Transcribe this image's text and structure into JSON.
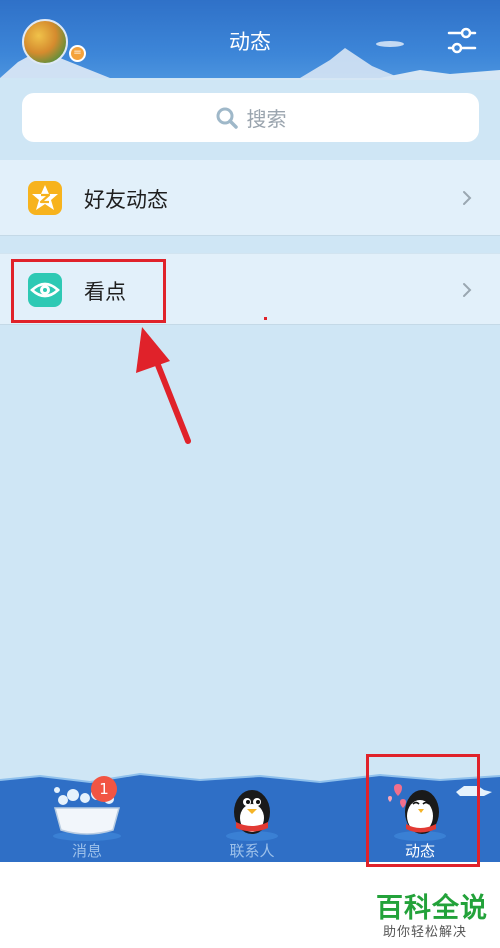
{
  "header": {
    "title": "动态",
    "avatar_badge": "=",
    "settings_icon": "sliders-icon"
  },
  "search": {
    "placeholder": "搜索",
    "icon": "search-icon"
  },
  "rows": [
    {
      "label": "好友动态",
      "icon": "star-z-icon",
      "icon_color": "#f7b31d"
    },
    {
      "label": "看点",
      "icon": "eye-icon",
      "icon_color": "#2ec9b4"
    }
  ],
  "tabbar": {
    "tabs": [
      {
        "label": "消息",
        "icon": "bathtub-icon",
        "badge": "1",
        "active": false
      },
      {
        "label": "联系人",
        "icon": "penguin-icon",
        "active": false
      },
      {
        "label": "动态",
        "icon": "penguin-hearts-icon",
        "active": true
      }
    ],
    "background": "#2f6fc6"
  },
  "watermark": {
    "title": "百科全说",
    "subtitle": "助你轻松解决"
  },
  "colors": {
    "accent_red": "#e0222a",
    "page_bg": "#cfe6f5"
  }
}
